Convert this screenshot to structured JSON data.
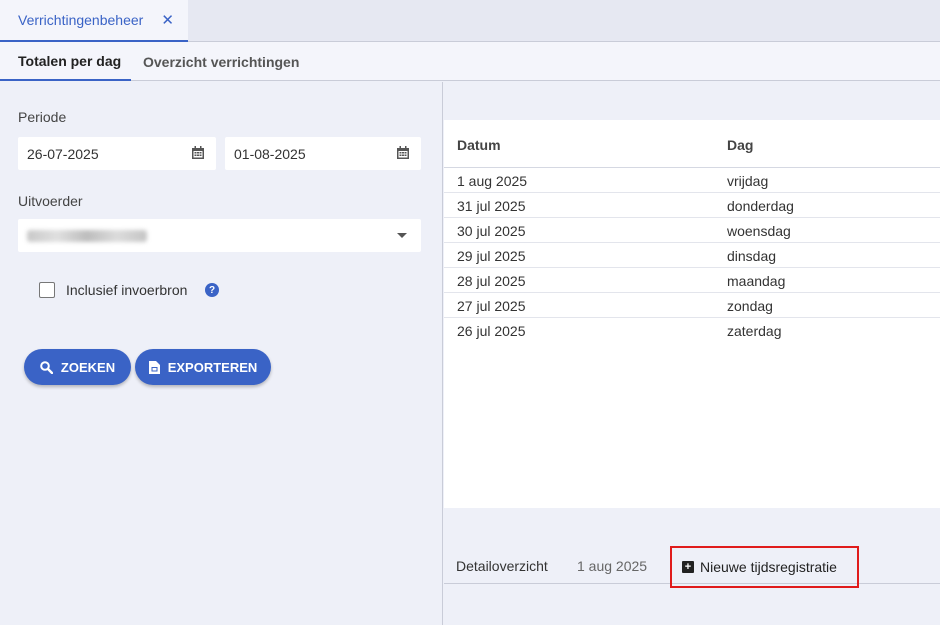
{
  "app_tab": {
    "label": "Verrichtingenbeheer",
    "close": "✕"
  },
  "subtabs": [
    "Totalen per dag",
    "Overzicht verrichtingen"
  ],
  "filters": {
    "periode_label": "Periode",
    "date_from": "26-07-2025",
    "date_to": "01-08-2025",
    "uitvoerder_label": "Uitvoerder",
    "checkbox_label": "Inclusief invoerbron",
    "help_icon": "?"
  },
  "buttons": {
    "zoeken": "ZOEKEN",
    "exporteren": "EXPORTEREN"
  },
  "table": {
    "headers": [
      "Datum",
      "Dag"
    ],
    "rows": [
      [
        "1 aug 2025",
        "vrijdag"
      ],
      [
        "31 jul 2025",
        "donderdag"
      ],
      [
        "30 jul 2025",
        "woensdag"
      ],
      [
        "29 jul 2025",
        "dinsdag"
      ],
      [
        "28 jul 2025",
        "maandag"
      ],
      [
        "27 jul 2025",
        "zondag"
      ],
      [
        "26 jul 2025",
        "zaterdag"
      ]
    ]
  },
  "detail": {
    "label": "Detailoverzicht",
    "date": "1 aug 2025",
    "new_registration": "Nieuwe tijdsregistratie"
  },
  "colors": {
    "accent": "#3a63c6",
    "highlight": "#e01b1b"
  }
}
